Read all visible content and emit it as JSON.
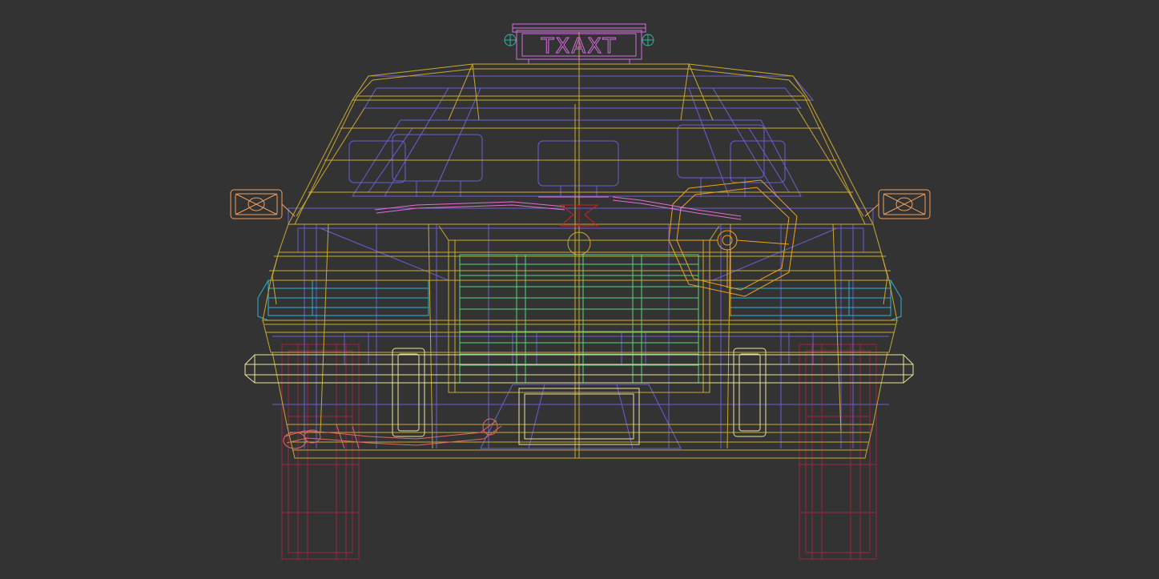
{
  "viewport": {
    "background": "#333333"
  },
  "wire_colors": {
    "body": "#c8a82e",
    "interior": "#6a5fd6",
    "roof_sign": "#d46ce0",
    "sign_lights": "#2fb6a6",
    "mirrors": "#f0a060",
    "grille": "#5ad67a",
    "headlights": "#2ab4d4",
    "bumper": "#e8e49a",
    "wheels": "#a0243c",
    "steering": "#f0a020",
    "hood_ornament": "#d02020",
    "exhaust": "#e06a6a",
    "wipers": "#e070d0"
  },
  "model": {
    "roof_sign_text": "TXAXT"
  }
}
